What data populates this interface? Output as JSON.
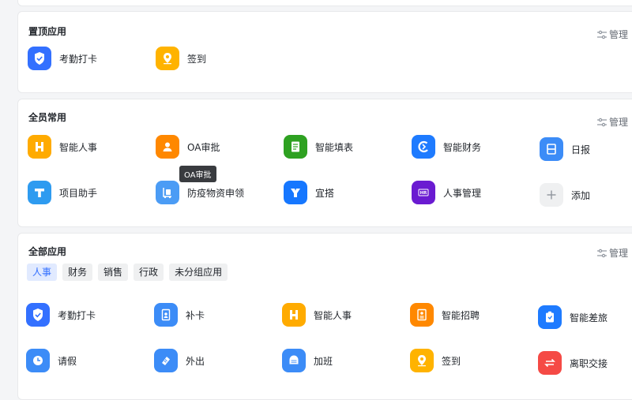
{
  "pinned": {
    "title": "置顶应用",
    "manage": "管理",
    "apps": [
      {
        "label": "考勤打卡",
        "icon": "check-shield-icon",
        "color": "#3370ff"
      },
      {
        "label": "签到",
        "icon": "location-pin-icon",
        "color": "#ffb300"
      }
    ]
  },
  "common": {
    "title": "全员常用",
    "manage": "管理",
    "apps": [
      {
        "label": "智能人事",
        "icon": "h-logo-icon",
        "color": "#ffab00"
      },
      {
        "label": "OA审批",
        "icon": "person-icon",
        "color": "#ff8800"
      },
      {
        "label": "智能填表",
        "icon": "form-icon",
        "color": "#2ea121"
      },
      {
        "label": "智能财务",
        "icon": "finance-icon",
        "color": "#1e7bff"
      },
      {
        "label": "日报",
        "icon": "calendar-day-icon",
        "color": "#3c8cf7"
      },
      {
        "label": "项目助手",
        "icon": "t-logo-icon",
        "color": "#2e9bf0"
      },
      {
        "label": "防疫物资申领",
        "icon": "supplies-icon",
        "color": "#4b9cf5"
      },
      {
        "label": "宜搭",
        "icon": "y-logo-icon",
        "color": "#1677ff"
      },
      {
        "label": "人事管理",
        "icon": "hr-icon",
        "color": "#6a1bd1"
      },
      {
        "label": "添加",
        "icon": "plus-icon",
        "color": "#eff0f1"
      }
    ]
  },
  "tooltip": "OA审批",
  "all": {
    "title": "全部应用",
    "manage": "管理",
    "tabs": [
      "人事",
      "财务",
      "销售",
      "行政",
      "未分组应用"
    ],
    "active_tab": "人事",
    "apps": [
      {
        "label": "考勤打卡",
        "icon": "check-shield-icon",
        "color": "#3370ff"
      },
      {
        "label": "补卡",
        "icon": "card-icon",
        "color": "#3c8cf7"
      },
      {
        "label": "智能人事",
        "icon": "h-logo-icon",
        "color": "#ffab00"
      },
      {
        "label": "智能招聘",
        "icon": "recruit-icon",
        "color": "#ff8800"
      },
      {
        "label": "智能差旅",
        "icon": "travel-icon",
        "color": "#1e7bff"
      },
      {
        "label": "请假",
        "icon": "clock-icon",
        "color": "#3c8cf7"
      },
      {
        "label": "外出",
        "icon": "outing-icon",
        "color": "#3c8cf7"
      },
      {
        "label": "加班",
        "icon": "overtime-icon",
        "color": "#3c8cf7"
      },
      {
        "label": "签到",
        "icon": "location-pin-icon",
        "color": "#ffb300"
      },
      {
        "label": "离职交接",
        "icon": "swap-icon",
        "color": "#f54a45"
      }
    ]
  }
}
